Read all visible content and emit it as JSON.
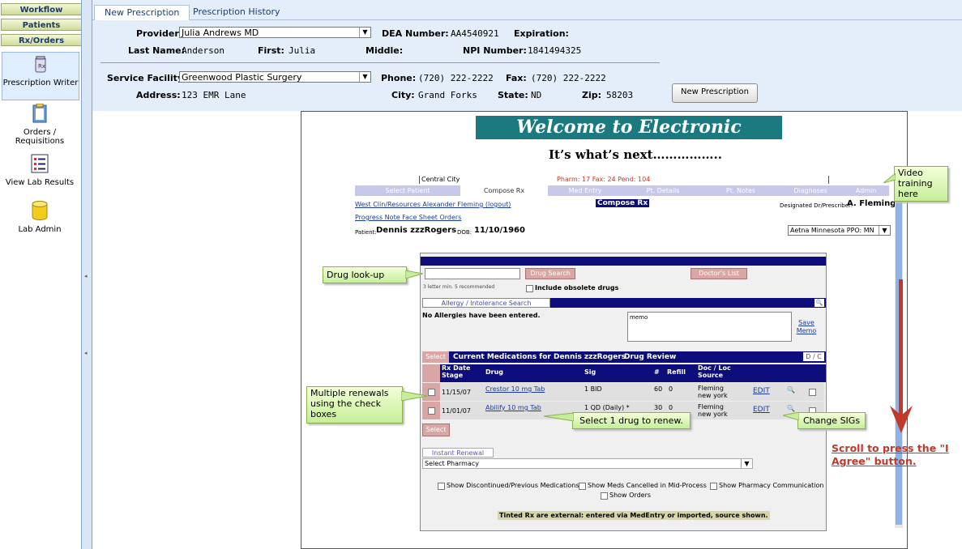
{
  "sidebar": {
    "workflow": "Workflow",
    "patients": "Patients",
    "rxorders": "Rx/Orders",
    "items": [
      {
        "label": "Prescription Writer"
      },
      {
        "label": "Orders / Requisitions"
      },
      {
        "label": "View Lab Results"
      },
      {
        "label": "Lab Admin"
      }
    ]
  },
  "tabs": {
    "new_rx": "New Prescription",
    "history": "Prescription History"
  },
  "provider": {
    "provider_label": "Provider:",
    "provider_value": "Julia Andrews MD",
    "dea_label": "DEA Number:",
    "dea_value": "AA4540921",
    "exp_label": "Expiration:",
    "lastname_label": "Last Name:",
    "lastname_value": "Anderson",
    "first_label": "First:",
    "first_value": "Julia",
    "middle_label": "Middle:",
    "npi_label": "NPI Number:",
    "npi_value": "1841494325"
  },
  "facility": {
    "label": "Service Facility:",
    "value": "Greenwood Plastic Surgery",
    "phone_label": "Phone:",
    "phone_value": "(720) 222-2222",
    "fax_label": "Fax:",
    "fax_value": "(720) 222-2222",
    "address_label": "Address:",
    "address_value": "123 EMR Lane",
    "city_label": "City:",
    "city_value": "Grand Forks",
    "state_label": "State:",
    "state_value": "ND",
    "zip_label": "Zip:",
    "zip_value": "58203"
  },
  "new_prescription_button": "New Prescription",
  "content": {
    "welcome": "Welcome to Electronic Prescribing!",
    "next": "It’s what’s next……………..",
    "central_city": "Central City",
    "pharm": "Pharm: 17  Fax: 24  Pend: 104",
    "ptabs": [
      "Select Patient",
      "Compose Rx",
      "Med Entry",
      "Pt. Details",
      "Pt. Notes",
      "Diagnoses",
      "Admin"
    ],
    "links1": "West Clin/Resources  Alexander Fleming (logout)",
    "compose_label": "Compose Rx",
    "designated": "Designated Dr/Prescriber:",
    "designated_name": "A. Fleming",
    "links2": "Progress Note  Face Sheet  Orders",
    "patient_label": "Patient:",
    "patient_name": "Dennis zzzRogers",
    "dob_label": "DOB:",
    "dob": "11/10/1960",
    "insurance": "Aetna Minnesota PPO: MN",
    "drug_search": "Drug Search",
    "doctors_list": "Doctor's List",
    "letter_hint": "3 letter min. 5 recommended",
    "include_obsolete": "Include obsolete drugs",
    "allergy_search": "Allergy / Intolerance Search",
    "no_allergies": "No Allergies have been entered.",
    "memo": "memo",
    "save_memo": "Save Memo",
    "select": "Select",
    "current_meds": "Current Medications for Dennis zzzRogers",
    "drug_review": "Drug Review",
    "dc": "D / C",
    "cols": {
      "date": "Rx Date Stage",
      "drug": "Drug",
      "sig": "Sig",
      "num": "#",
      "refill": "Refill",
      "doc": "Doc / Loc Source"
    },
    "rows": [
      {
        "date": "11/15/07",
        "drug": "Crestor 10 mg Tab",
        "sig": "1 BID",
        "num": "60",
        "refill": "0",
        "doc1": "Fleming",
        "doc2": "new york",
        "edit": "EDIT"
      },
      {
        "date": "11/01/07",
        "drug": "Abilify 10 mg Tab",
        "sig": "1 QD (Daily) *",
        "num": "30",
        "refill": "0",
        "doc1": "Fleming",
        "doc2": "new york",
        "edit": "EDIT"
      }
    ],
    "instant_renewal": "Instant Renewal",
    "select_pharmacy": "Select Pharmacy",
    "show_disc": "Show Discontinued/Previous Medications",
    "show_cancelled": "Show Meds Cancelled in Mid-Process",
    "show_pharm_comm": "Show Pharmacy Communication",
    "show_orders": "Show Orders",
    "tinted": "Tinted Rx are external: entered via MedEntry or imported, source shown."
  },
  "callouts": {
    "video": "Video training here",
    "drug_lookup": "Drug look-up",
    "multiple": "Multiple renewals using the check boxes",
    "select1": "Select 1 drug to renew.",
    "change_sigs": "Change SIGs"
  },
  "scroll_note": "Scroll to press the \"I Agree\" button.",
  "colors": {
    "teal": "#1a7a80",
    "navy": "#0c0c7a",
    "arrow": "#c0392b",
    "callout": "#c6ee9a"
  }
}
